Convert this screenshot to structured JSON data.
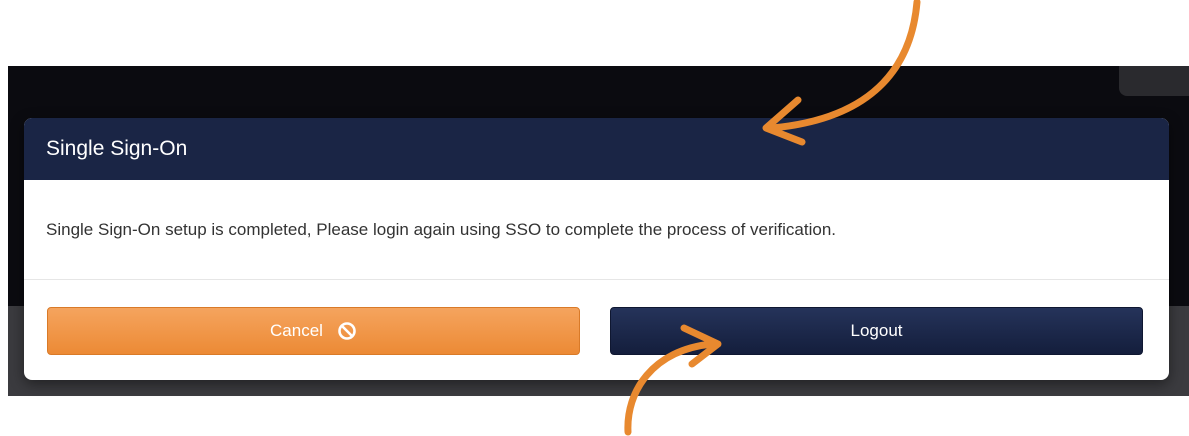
{
  "modal": {
    "title": "Single Sign-On",
    "message": "Single Sign-On setup is completed, Please login again using SSO to complete the process of verification.",
    "cancel_label": "Cancel",
    "cancel_icon": "ban-icon",
    "logout_label": "Logout"
  },
  "colors": {
    "header": "#1a2545",
    "cancel": "#ec8a35",
    "logout": "#1a2545",
    "annotation_arrow": "#e8892f"
  }
}
